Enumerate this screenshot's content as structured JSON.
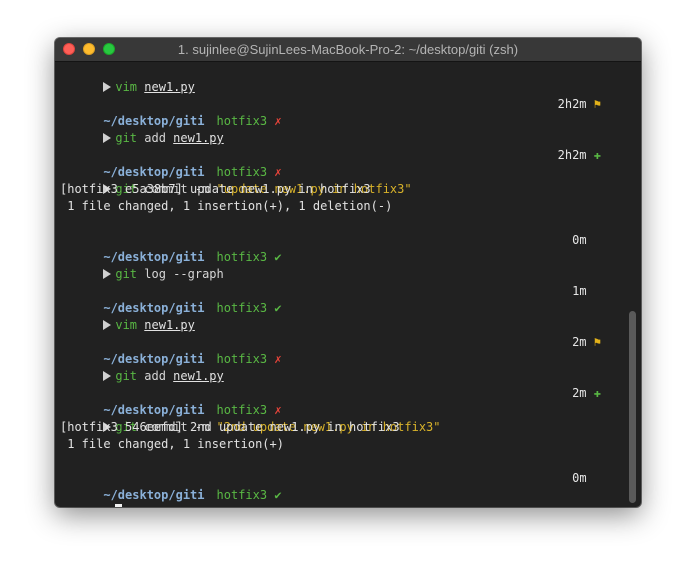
{
  "window": {
    "title": "1. sujinlee@SujinLees-MacBook-Pro-2: ~/desktop/giti (zsh)"
  },
  "icons": {
    "prompt": "triangle-right-icon",
    "dirty": "cross-mark-icon",
    "clean": "check-mark-icon",
    "flag": "flag-icon",
    "plus": "plus-icon"
  },
  "colors": {
    "background": "#212121",
    "path": "#8ab0d8",
    "branch": "#59b844",
    "dirty": "#e8443a",
    "string": "#d9b32a"
  },
  "terminal": {
    "cmd1": {
      "cmd": "vim",
      "arg": "new1.py"
    },
    "p1": {
      "path": "~/desktop/giti",
      "branch": "hotfix3",
      "status": "✗",
      "time": "2h2m",
      "badge": "⚑"
    },
    "cmd2": {
      "cmd": "git",
      "rest": " add ",
      "arg": "new1.py"
    },
    "p2": {
      "path": "~/desktop/giti",
      "branch": "hotfix3",
      "status": "✗",
      "time": "2h2m",
      "badge": "✚"
    },
    "cmd3": {
      "cmd": "git",
      "rest": " commit -m ",
      "str": "\"update new1.py in hotfix3\""
    },
    "out3a": "[hotfix3 e5a38b7] update new1.py in hotfix3",
    "out3b": " 1 file changed, 1 insertion(+), 1 deletion(-)",
    "p3": {
      "path": "~/desktop/giti",
      "branch": "hotfix3",
      "status": "✔",
      "time": "0m"
    },
    "cmd4": {
      "cmd": "git",
      "rest": " log --graph"
    },
    "p4": {
      "path": "~/desktop/giti",
      "branch": "hotfix3",
      "status": "✔",
      "time": "1m"
    },
    "cmd5": {
      "cmd": "vim",
      "arg": "new1.py"
    },
    "p5": {
      "path": "~/desktop/giti",
      "branch": "hotfix3",
      "status": "✗",
      "time": "2m",
      "badge": "⚑"
    },
    "cmd6": {
      "cmd": "git",
      "rest": " add ",
      "arg": "new1.py"
    },
    "p6": {
      "path": "~/desktop/giti",
      "branch": "hotfix3",
      "status": "✗",
      "time": "2m",
      "badge": "✚"
    },
    "cmd7": {
      "cmd": "git",
      "rest": " commit -m ",
      "str": "\"2nd update new1.py in hotfix3\""
    },
    "out7a": "[hotfix3 546eefd] 2nd update new1.py in hotfix3",
    "out7b": " 1 file changed, 1 insertion(+)",
    "p7": {
      "path": "~/desktop/giti",
      "branch": "hotfix3",
      "status": "✔",
      "time": "0m"
    }
  }
}
